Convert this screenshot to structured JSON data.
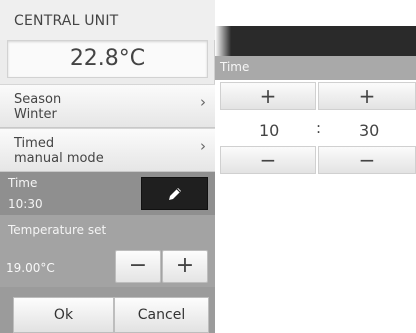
{
  "central_unit": {
    "title": "CENTRAL UNIT",
    "temperature": "22.8°C"
  },
  "menu": {
    "season": {
      "label": "Season",
      "value": "Winter"
    },
    "timed": {
      "label": "Timed",
      "value": "manual mode"
    },
    "chevron": "›"
  },
  "time": {
    "label": "Time",
    "value": "10:30",
    "edit_icon": "pencil-icon"
  },
  "temperature_set": {
    "label": "Temperature set",
    "value": "19.00°C",
    "minus": "−",
    "plus": "+"
  },
  "actions": {
    "ok": "Ok",
    "cancel": "Cancel"
  },
  "time_editor": {
    "title": "Time",
    "hours": "10",
    "minutes": "30",
    "separator": ":",
    "plus": "+",
    "minus": "−"
  },
  "colors": {
    "time_row": "#8f8f8f",
    "temp_set_row": "#a3a3a3",
    "edit_button": "#1f1f1f"
  }
}
